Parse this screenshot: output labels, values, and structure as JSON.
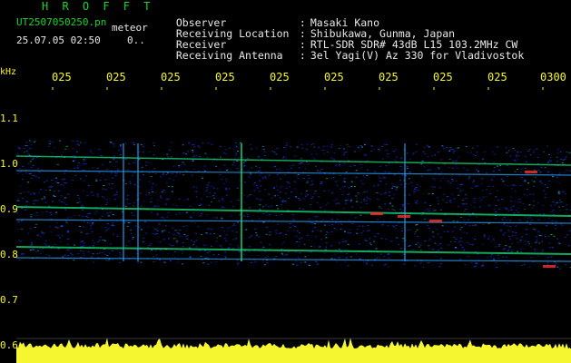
{
  "header": {
    "title": "H R O F F T",
    "filename": "UT2507050250.pn",
    "file_tag": "meteor",
    "datetime": "25.07.05 02:50",
    "datetime_suffix": "0..",
    "meta": [
      {
        "label": "Observer",
        "value": "Masaki Kano"
      },
      {
        "label": "Receiving Location",
        "value": "Shibukawa, Gunma, Japan"
      },
      {
        "label": "Receiver",
        "value": "RTL-SDR SDR# 43dB L15 103.2MHz CW"
      },
      {
        "label": "Receiving Antenna",
        "value": "3el Yagi(V) Az 330 for Vladivostok"
      }
    ]
  },
  "axis": {
    "unit": "kHz",
    "x_ticks": [
      "025",
      "025",
      "025",
      "025",
      "025",
      "025",
      "025",
      "025",
      "025",
      "0300"
    ],
    "y_ticks": [
      "1.1",
      "1.0",
      "0.9",
      "0.8",
      "0.7",
      "0.6"
    ]
  },
  "colors": {
    "background": "#000000",
    "label_green": "#19d62c",
    "axis_yellow": "#f5f530",
    "signal_blue": "#1a3cff",
    "signal_green": "#19e07a",
    "signal_red": "#ff3030",
    "power_trace": "#f5f530"
  }
}
